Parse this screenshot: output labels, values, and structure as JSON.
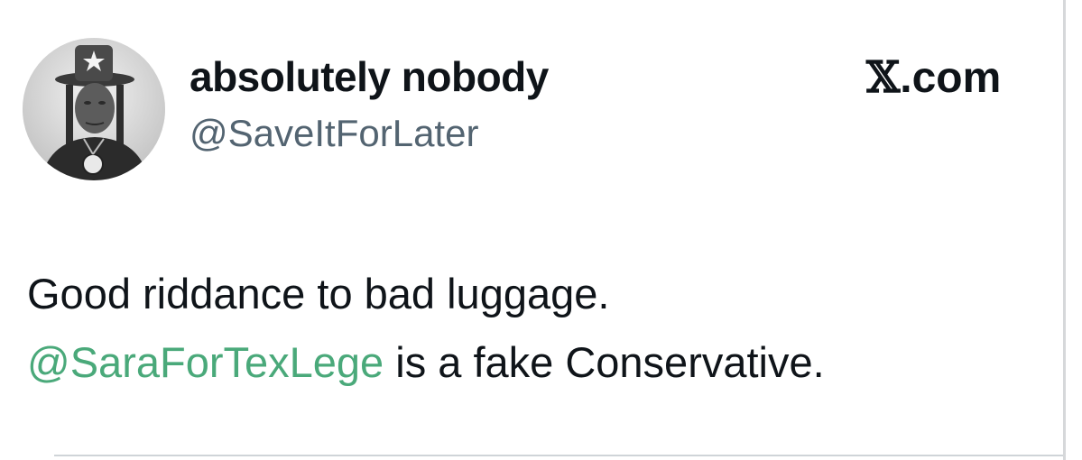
{
  "author": {
    "display_name": "absolutely nobody",
    "handle": "@SaveItForLater"
  },
  "source": {
    "x_glyph": "𝕏",
    "domain_suffix": ".com"
  },
  "tweet": {
    "line1": "Good riddance to bad luggage.",
    "mention": "@SaraForTexLege",
    "line2_rest": " is a fake Conservative."
  },
  "colors": {
    "mention": "#4aa97a",
    "handle": "#536471",
    "text": "#0f1419"
  }
}
